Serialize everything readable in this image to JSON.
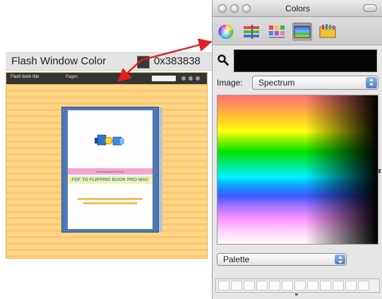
{
  "flash_window": {
    "label": "Flash Window Color",
    "hex_value": "0x383838",
    "swatch_color": "#383838",
    "toolbar_title": "Flash book title",
    "toolbar_pages": "Pages"
  },
  "book": {
    "band_text": "www.flipping-book.com",
    "title": "PDF TO FLIPPING BOOK PRO MAC"
  },
  "colors_window": {
    "title": "Colors",
    "modes": [
      "color-wheel",
      "color-sliders",
      "color-palettes",
      "image-palettes",
      "crayons"
    ],
    "active_mode": "image-palettes",
    "current_color": "#050505",
    "image_label": "Image:",
    "image_value": "Spectrum",
    "palette_value": "Palette"
  }
}
